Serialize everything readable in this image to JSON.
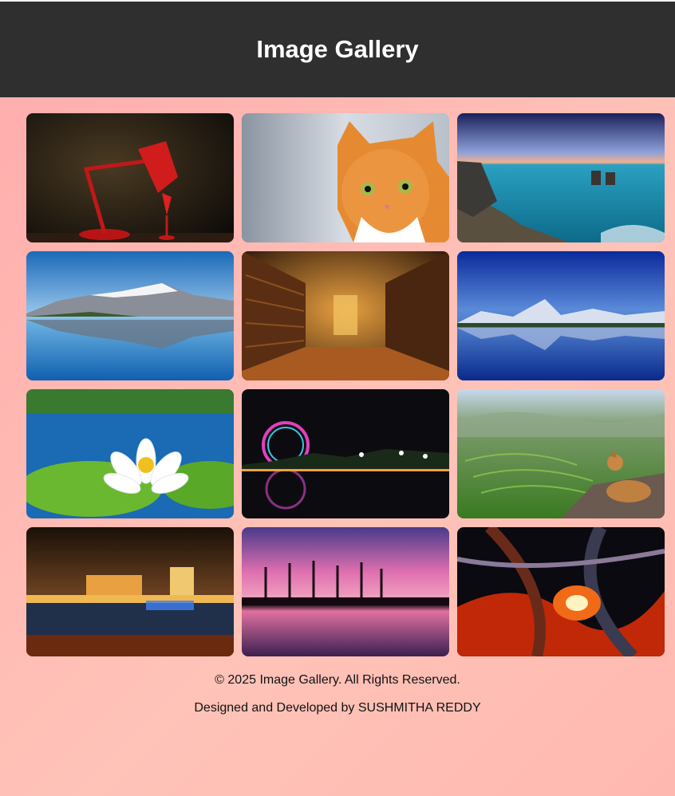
{
  "header": {
    "title": "Image Gallery"
  },
  "gallery": {
    "images": [
      {
        "subject": "red desk lamp"
      },
      {
        "subject": "orange cat"
      },
      {
        "subject": "ocean cliffs at sunset"
      },
      {
        "subject": "snowy mountain lake reflection"
      },
      {
        "subject": "library interior"
      },
      {
        "subject": "mountain lake reflection"
      },
      {
        "subject": "white water lily"
      },
      {
        "subject": "ferris wheel at night"
      },
      {
        "subject": "rice terraces with dog"
      },
      {
        "subject": "city lights at night"
      },
      {
        "subject": "pink sunset trees reflection"
      },
      {
        "subject": "abstract fractal art"
      }
    ]
  },
  "footer": {
    "copyright": "© 2025 Image Gallery. All Rights Reserved.",
    "credit": "Designed and Developed by SUSHMITHA REDDY"
  }
}
